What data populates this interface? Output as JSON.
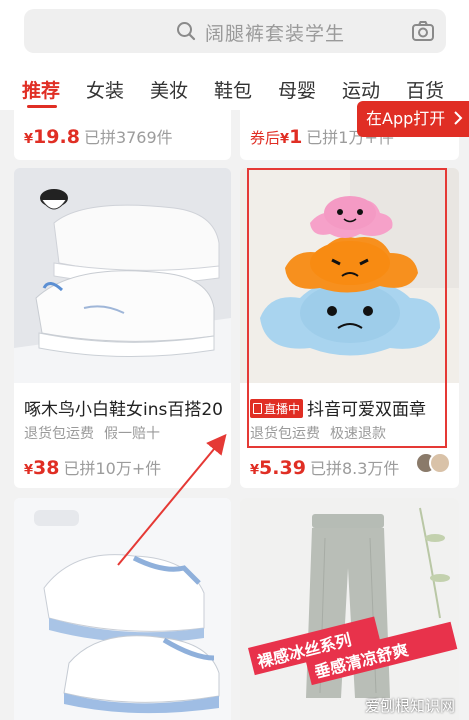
{
  "search": {
    "placeholder_text": "阔腿裤套装学生"
  },
  "tabs": [
    "推荐",
    "女装",
    "美妆",
    "鞋包",
    "母婴",
    "运动",
    "百货"
  ],
  "app_banner": "在App打开",
  "top_cards": {
    "left": {
      "currency": "¥",
      "price": "19.8",
      "sold": "已拼3769件"
    },
    "right": {
      "prefix": "券后",
      "currency": "¥",
      "price": "1",
      "sold": "已拼1万+件"
    }
  },
  "products": [
    {
      "title": "啄木鸟小白鞋女ins百搭20",
      "tags": [
        "退货包运费",
        "假一赔十"
      ],
      "currency": "¥",
      "price": "38",
      "sold": "已拼10万+件"
    },
    {
      "badge": "直播中",
      "title": "抖音可爱双面章",
      "tags": [
        "退货包运费",
        "极速退款"
      ],
      "currency": "¥",
      "price": "5.39",
      "sold": "已拼8.3万件"
    }
  ],
  "bottom_right_overlay": {
    "line1": "裸感冰丝系列",
    "line2": "垂感清凉舒爽"
  },
  "watermark": "爱刨根知识网",
  "colors": {
    "accent": "#e02e24",
    "annotation": "#e53935"
  }
}
